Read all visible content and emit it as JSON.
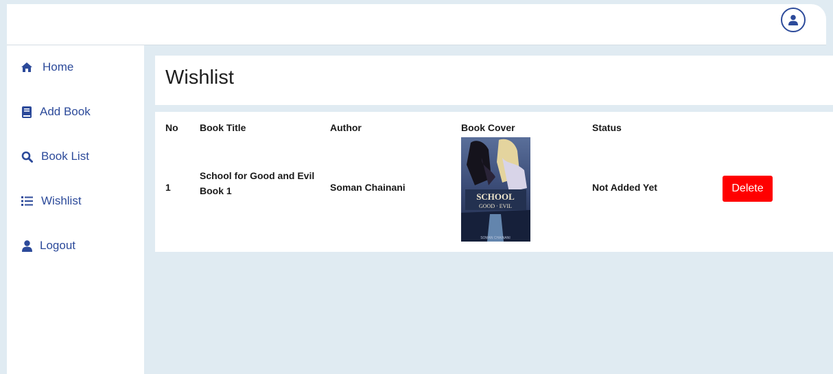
{
  "sidebar": {
    "items": [
      {
        "label": "Home",
        "icon": "home-icon"
      },
      {
        "label": "Add Book",
        "icon": "book-icon"
      },
      {
        "label": "Book List",
        "icon": "search-icon"
      },
      {
        "label": "Wishlist",
        "icon": "list-icon"
      },
      {
        "label": "Logout",
        "icon": "user-icon"
      }
    ]
  },
  "header": {
    "avatar_icon": "user-circle-icon"
  },
  "main": {
    "title": "Wishlist",
    "table": {
      "columns": [
        "No",
        "Book Title",
        "Author",
        "Book Cover",
        "Status"
      ],
      "rows": [
        {
          "no": "1",
          "title": "School for Good and Evil Book 1",
          "author": "Soman Chainani",
          "status": "Not Added Yet",
          "action": "Delete"
        }
      ]
    }
  },
  "colors": {
    "accent": "#2c4a9a",
    "background": "#e0ebf2",
    "delete": "#ff0000"
  }
}
